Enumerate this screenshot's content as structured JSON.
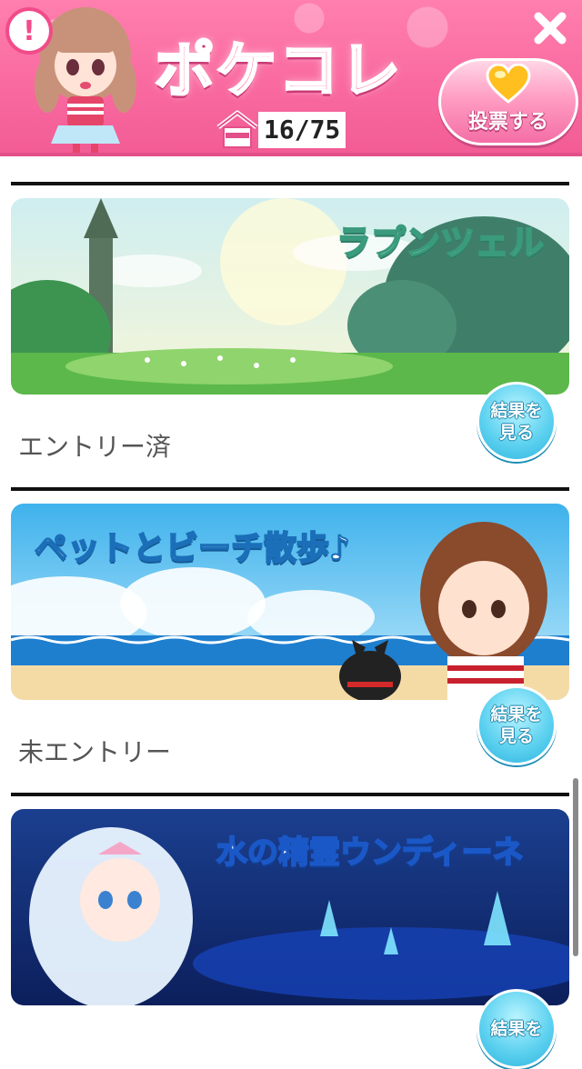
{
  "header": {
    "logo_text": "ポケコレ",
    "progress_count": "16/75",
    "vote_label": "投票する",
    "alert_symbol": "!",
    "icons": [
      "alert-icon",
      "close-icon",
      "house-icon",
      "heart-icon"
    ]
  },
  "entries": [
    {
      "title": "ラプンツェル",
      "status": "エントリー済",
      "result_label": "結果を\n見る",
      "theme_color": "#7ccf5a"
    },
    {
      "title": "ペットとビーチ散歩♪",
      "status": "未エントリー",
      "result_label": "結果を\n見る",
      "theme_color": "#4fb8ea"
    },
    {
      "title": "水の精霊ウンディーネ",
      "status": "",
      "result_label": "結果を",
      "theme_color": "#1f58c9"
    }
  ],
  "colors": {
    "brand_pink": "#f96aa0",
    "result_button": "#5fd2f0"
  }
}
